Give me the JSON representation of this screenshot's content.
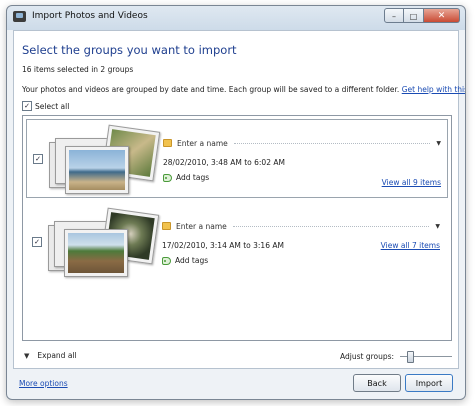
{
  "window": {
    "title": "Import Photos and Videos",
    "controls": {
      "minimize": "–",
      "maximize": "□",
      "close": "✕"
    }
  },
  "main": {
    "heading": "Select the groups you want to import",
    "summary": "16 items selected in 2 groups",
    "info": "Your photos and videos are grouped by date and time. Each group will be saved to a different folder.",
    "help_link": "Get help with this",
    "select_all": {
      "label": "Select all",
      "checked": true
    }
  },
  "groups": [
    {
      "checked": true,
      "name_placeholder": "Enter a name",
      "date_range": "28/02/2010, 3:48 AM to 6:02 AM",
      "tags_label": "Add tags",
      "view_all": "View all 9 items"
    },
    {
      "checked": true,
      "name_placeholder": "Enter a name",
      "date_range": "17/02/2010, 3:14 AM to 3:16 AM",
      "tags_label": "Add tags",
      "view_all": "View all 7 items"
    }
  ],
  "bottom": {
    "expand_all": "Expand all",
    "adjust_groups": "Adjust groups:",
    "adjust_groups_level": 0.15
  },
  "footer": {
    "more_options": "More options",
    "back": "Back",
    "import": "Import"
  },
  "colors": {
    "heading": "#1f3f8f",
    "link": "#1a4bb3",
    "close_button": "#c94a34"
  }
}
